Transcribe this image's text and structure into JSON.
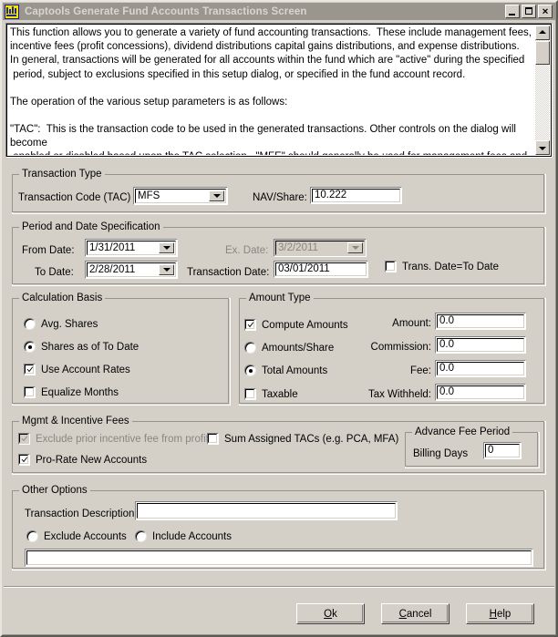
{
  "window": {
    "title": "Captools Generate Fund Accounts Transactions Screen",
    "icon": "app-icon",
    "minimize_label": "_",
    "maximize_label": "□",
    "close_label": "✕"
  },
  "help_text": {
    "paragraph1": "This function allows you to generate a variety of fund accounting transactions.  These include management fees,\nincentive fees (profit concessions), dividend distributions capital gains distributions, and expense distributions.\nIn general, transactions will be generated for all accounts within the fund which are \"active\" during the specified\n period, subject to exclusions specified in this setup dialog, or specified in the fund account record.",
    "paragraph2": "The operation of the various setup parameters is as follows:",
    "paragraph3": "\"TAC\":  This is the transaction code to be used in the generated transactions. Other controls on the dialog will become\n enabled or disabled based upon the TAC selection.  \"MFE\" should generally be used for management fees and \"PCN\" for\n incentive fees.",
    "scroll_up_icon": "scroll-up-arrow-icon",
    "scroll_down_icon": "scroll-down-arrow-icon"
  },
  "transaction_type": {
    "legend": "Transaction Type",
    "tac_label": "Transaction Code (TAC)",
    "tac_value": "MFS",
    "nav_label": "NAV/Share:",
    "nav_value": "10.222"
  },
  "period": {
    "legend": "Period and Date Specification",
    "from_label": "From Date:",
    "from_value": "1/31/2011",
    "to_label": "To Date:",
    "to_value": "2/28/2011",
    "ex_label": "Ex. Date:",
    "ex_value": "3/2/2011",
    "txn_date_label": "Transaction Date:",
    "txn_date_value": "03/01/2011",
    "trans_eq_to_label": "Trans. Date=To Date"
  },
  "calc_basis": {
    "legend": "Calculation Basis",
    "avg_shares": "Avg. Shares",
    "shares_as_of": "Shares as of To Date",
    "use_account_rates": "Use Account Rates",
    "equalize_months": "Equalize Months"
  },
  "amount_type": {
    "legend": "Amount Type",
    "compute_amounts": "Compute Amounts",
    "amounts_share": "Amounts/Share",
    "total_amounts": "Total Amounts",
    "taxable": "Taxable",
    "amount_label": "Amount:",
    "amount_value": "0.0",
    "commission_label": "Commission:",
    "commission_value": "0.0",
    "fee_label": "Fee:",
    "fee_value": "0.0",
    "tax_withheld_label": "Tax Withheld:",
    "tax_withheld_value": "0.0"
  },
  "mgmt_fees": {
    "legend": "Mgmt & Incentive Fees",
    "exclude_prior": "Exclude prior incentive fee from profit",
    "sum_assigned": "Sum Assigned TACs (e.g. PCA, MFA)",
    "prorate_new": "Pro-Rate New Accounts",
    "advance_legend": "Advance Fee Period",
    "billing_days_label": "Billing Days",
    "billing_days_value": "0"
  },
  "other_options": {
    "legend": "Other Options",
    "description_label": "Transaction Description:",
    "description_value": "",
    "exclude_accounts": "Exclude Accounts",
    "include_accounts": "Include Accounts",
    "accounts_value": ""
  },
  "footer": {
    "ok_pre": "O",
    "ok_key": "k",
    "ok_post": "",
    "cancel_pre": "",
    "cancel_key": "C",
    "cancel_post": "ancel",
    "help_pre": "",
    "help_key": "H",
    "help_post": "elp"
  },
  "colors": {
    "face": "#d4d0c8",
    "titlebar": "#9a968e",
    "field_bg": "#ffffff",
    "disabled_text": "#8a8680"
  }
}
